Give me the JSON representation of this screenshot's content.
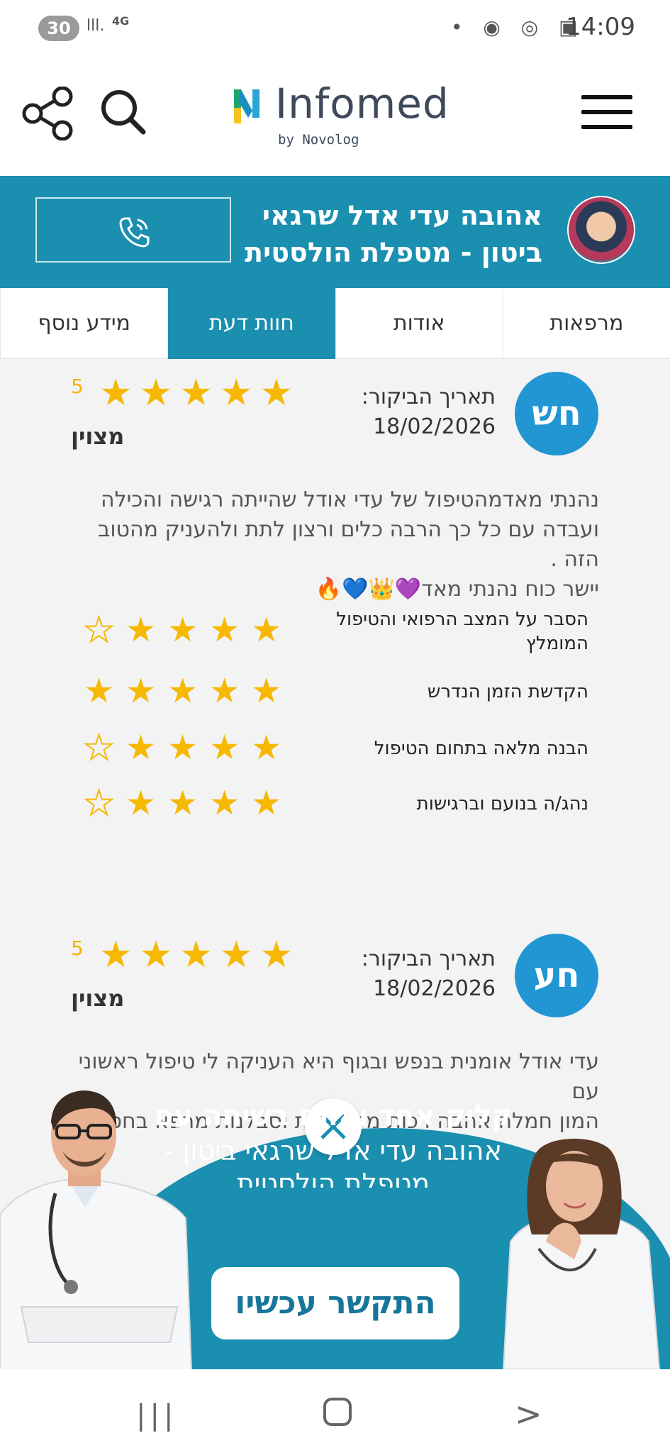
{
  "status_bar": {
    "battery_pill": "30",
    "signal": "lll.",
    "network": "4G",
    "time": "14:09"
  },
  "header": {
    "logo_text": "Infomed",
    "logo_sub": "by Novolog"
  },
  "doctor_banner": {
    "name_line1": "אהובה עדי אדל שרגאי",
    "name_line2": "ביטון - מטפלת הולסטית"
  },
  "tabs": [
    {
      "label": "מרפאות",
      "active": false
    },
    {
      "label": "אודות",
      "active": false
    },
    {
      "label": "חוות דעת",
      "active": true
    },
    {
      "label": "מידע נוסף",
      "active": false
    }
  ],
  "reviews": [
    {
      "initials": "חש",
      "date_label": "תאריך הביקור:",
      "date": "18/02/2026",
      "score": "5",
      "rating_text": "מצוין",
      "body_lines": [
        "נהנתי מאדמהטיפול של עדי אודל שהייתה רגישה והכילה",
        "ועבדה עם כל כך הרבה כלים ורצון לתת ולהעניק מהטוב הזה .",
        "יישר כוח נהנתי מאד💜👑💙🔥"
      ],
      "criteria": [
        {
          "label": "הסבר על המצב הרפואי והטיפול המומלץ",
          "stars": 4
        },
        {
          "label": "הקדשת הזמן הנדרש",
          "stars": 5
        },
        {
          "label": "הבנה מלאה בתחום הטיפול",
          "stars": 4
        },
        {
          "label": "נהג/ה בנועם וברגישות",
          "stars": 4
        }
      ]
    },
    {
      "initials": "חע",
      "date_label": "תאריך הביקור:",
      "date": "18/02/2026",
      "score": "5",
      "rating_text": "מצוין",
      "body_lines": [
        "עדי אודל אומנית בנפש ובגוף היא העניקה לי טיפול ראשוני עם",
        "המון חמלה אהבה רכות מקצועיות וסבלנות מרפא בחסד🙏"
      ]
    }
  ],
  "promo": {
    "line1": "קליק אחד ואתם בשיחה עם",
    "line2": "אהובה עדי אדל שרגאי ביטון -",
    "line3": "מטפלת הולסטית",
    "button": "התקשר עכשיו"
  },
  "colors": {
    "brand_blue": "#1a8fb0",
    "badge_blue": "#2196d3",
    "star_gold": "#f6b800"
  }
}
